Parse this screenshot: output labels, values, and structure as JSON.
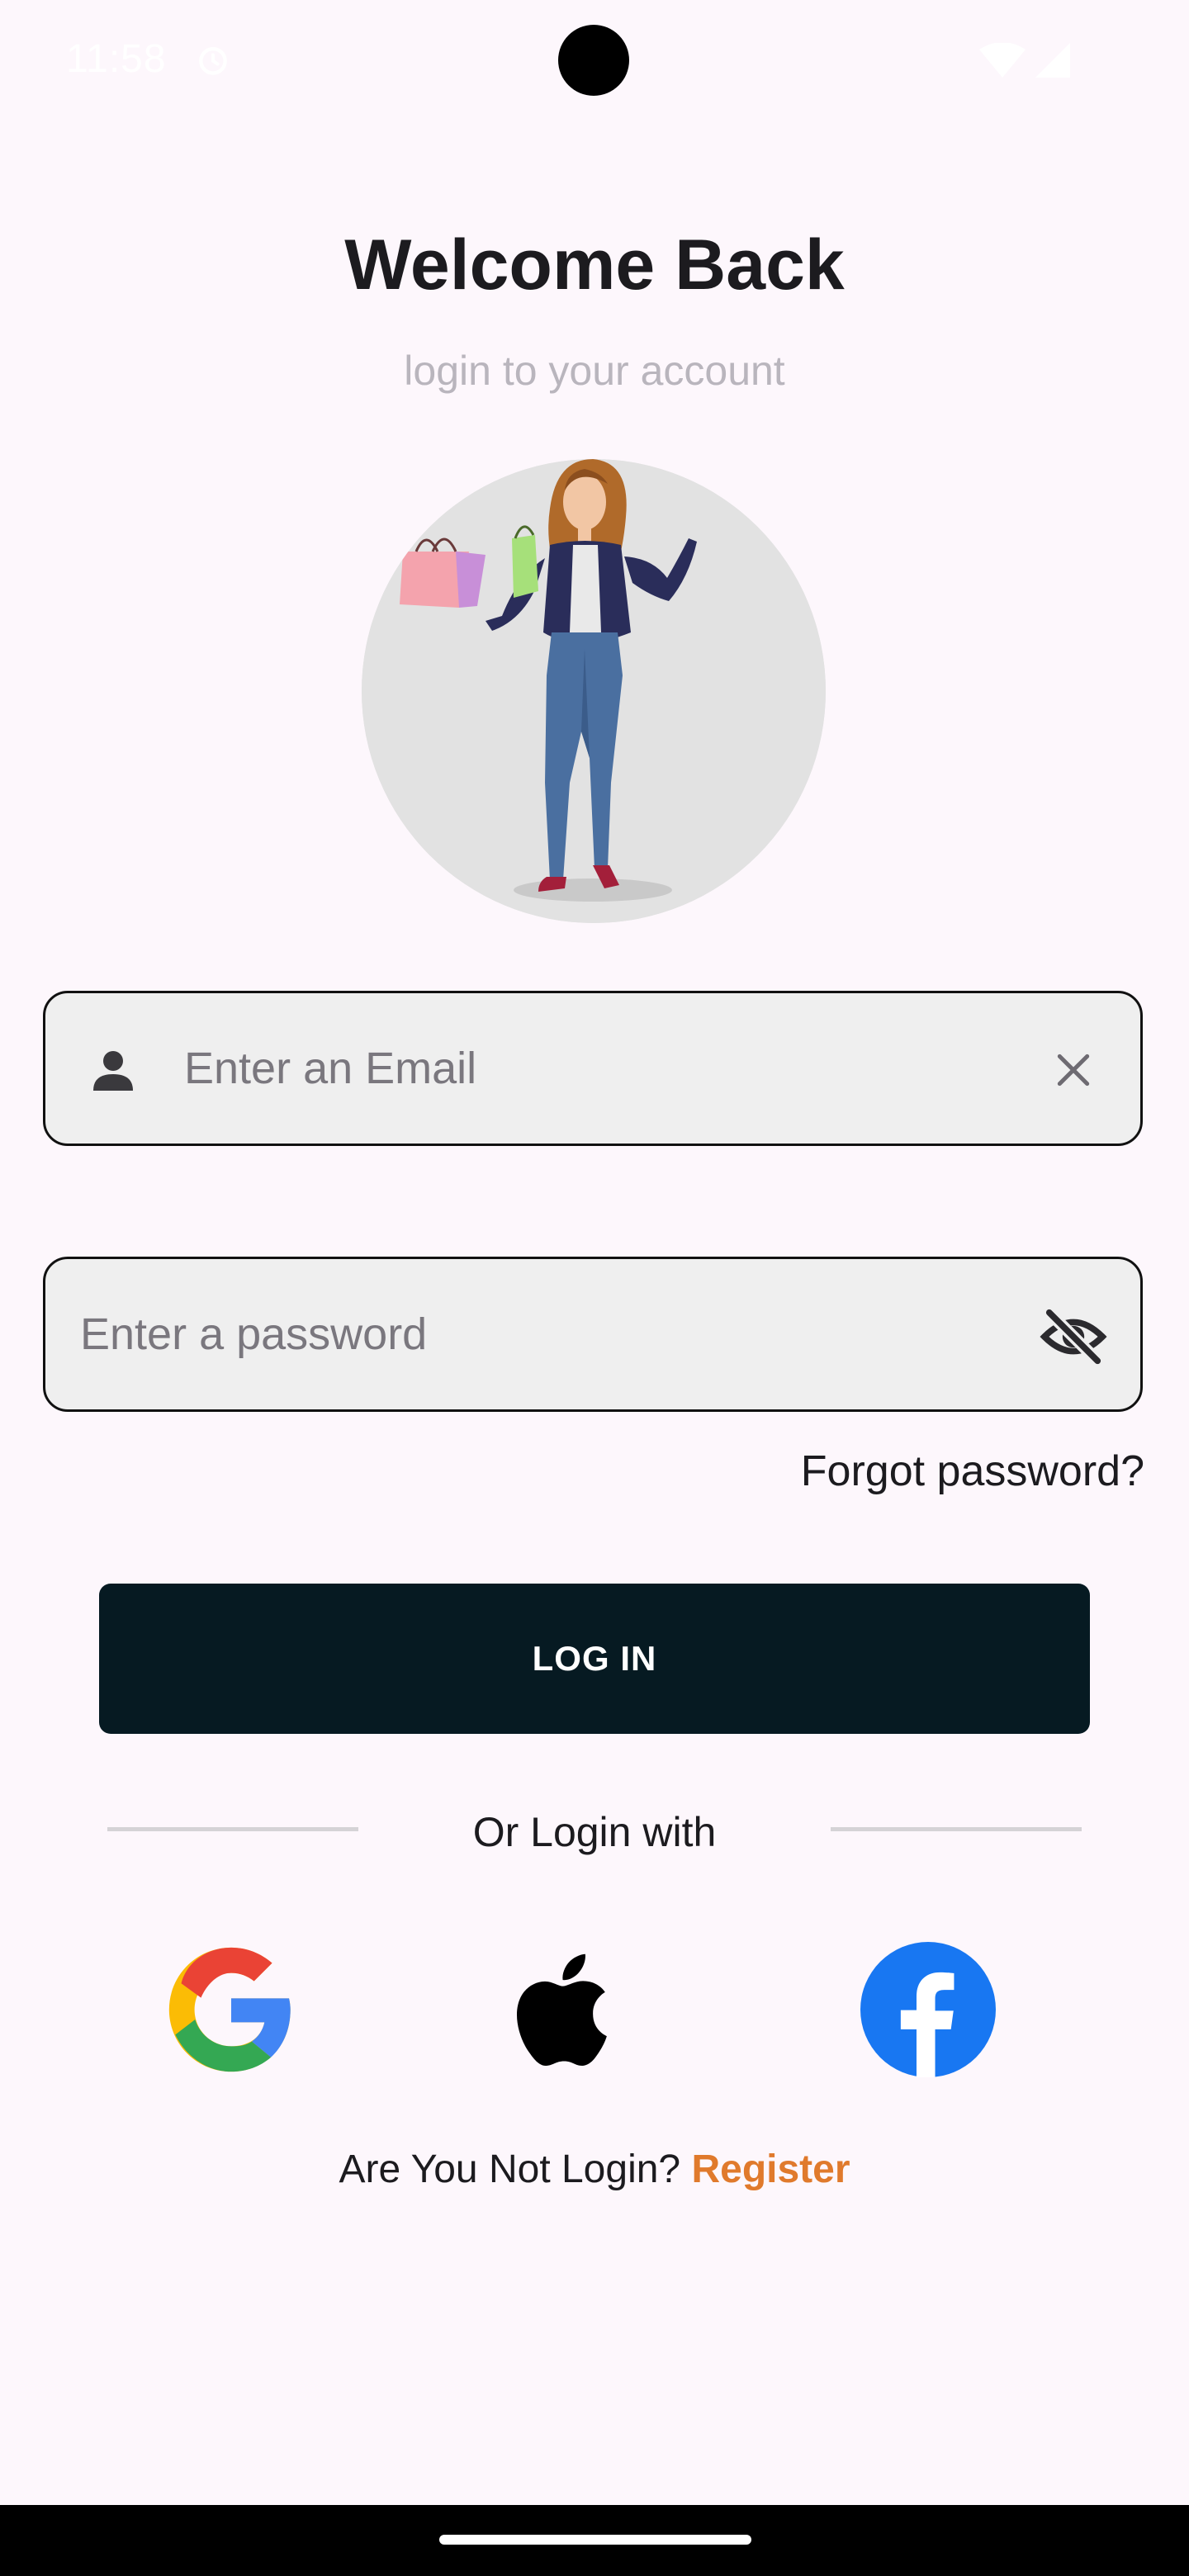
{
  "status_bar": {
    "time": "11:58",
    "icons": [
      "alarm-icon",
      "wifi-icon",
      "signal-icon"
    ]
  },
  "header": {
    "title": "Welcome Back",
    "subtitle": "login to your account"
  },
  "avatar": {
    "description_icon": "shopping-woman-illustration"
  },
  "form": {
    "email": {
      "value": "",
      "placeholder": "Enter an Email",
      "leading_icon": "person-icon",
      "trailing_icon": "close-icon"
    },
    "password": {
      "value": "",
      "placeholder": "Enter a password",
      "trailing_icon": "eye-off-icon"
    },
    "forgot_label": "Forgot password?",
    "login_label": "LOG IN"
  },
  "social": {
    "divider_label": "Or Login with",
    "providers": [
      "google-icon",
      "apple-icon",
      "facebook-icon"
    ]
  },
  "footer": {
    "question": "Are You Not Login?",
    "register_label": "Register"
  },
  "colors": {
    "background": "#fdf7fc",
    "button": "#061a22",
    "link": "#e07a2c",
    "field_background": "#efefef",
    "facebook": "#1877f2"
  }
}
